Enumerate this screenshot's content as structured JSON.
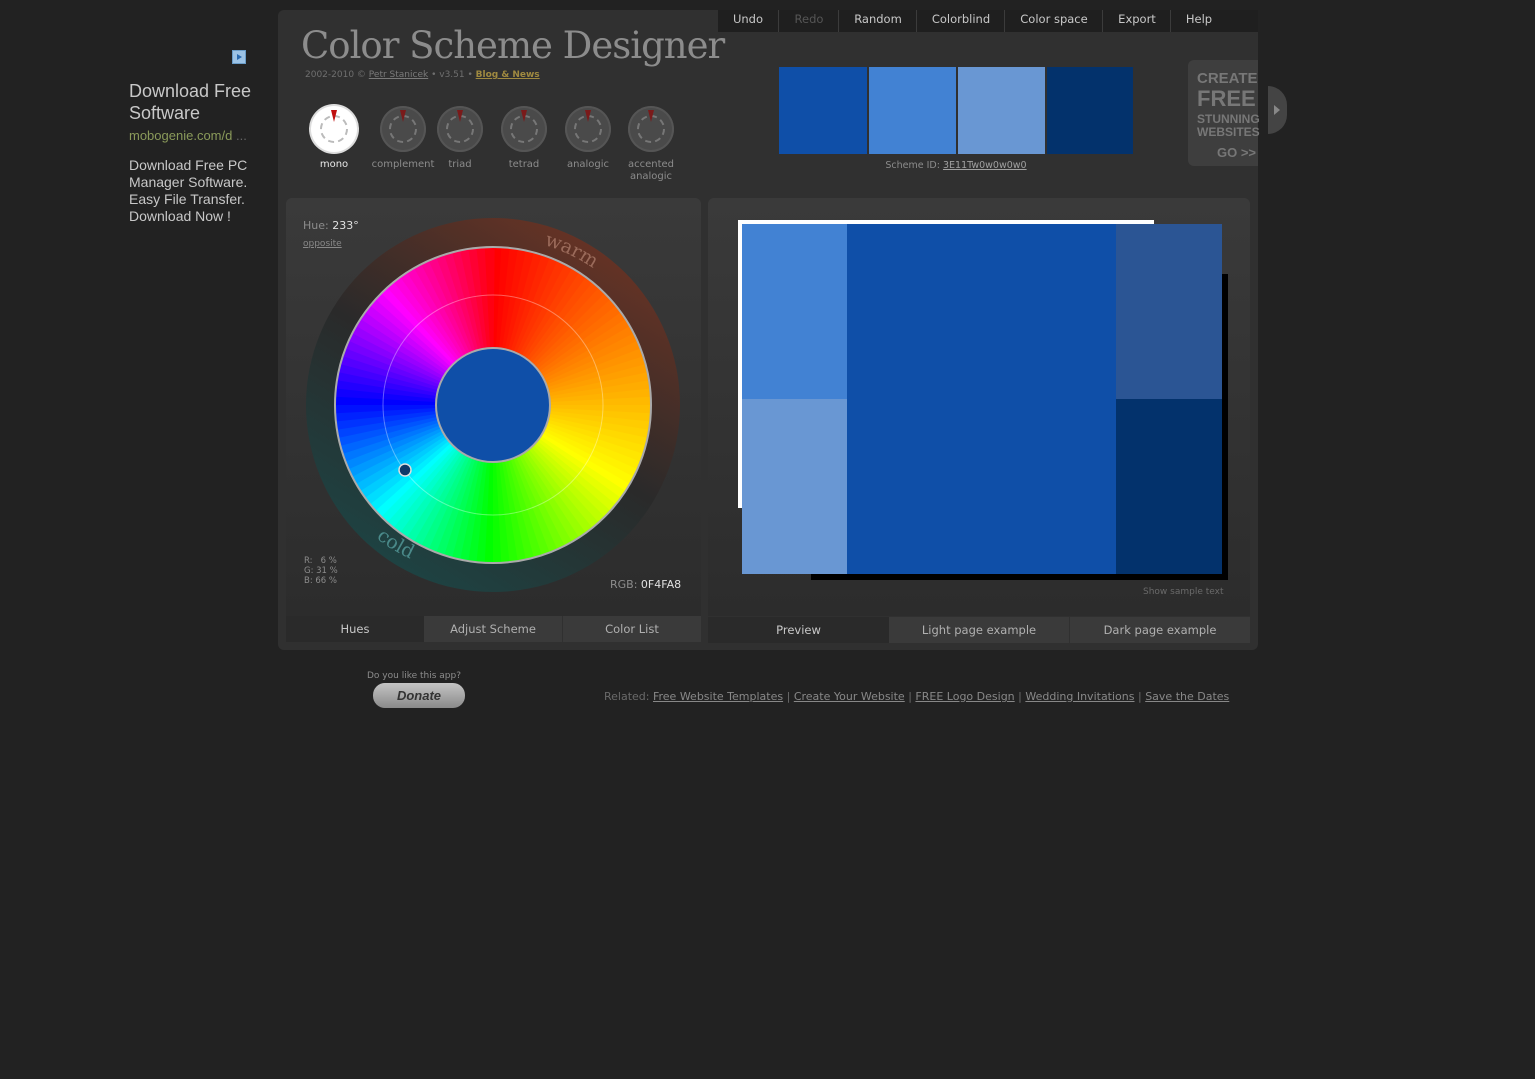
{
  "ad": {
    "title": "Download Free Software",
    "url": "mobogenie.com/d",
    "url_ellipsis": "...",
    "body": "Download Free PC Manager Software. Easy File Transfer. Download Now !"
  },
  "app": {
    "title": "Color Scheme Designer",
    "credits_prefix": "2002-2010 ©",
    "author": "Petr Stanicek",
    "version": "• v3.51 •",
    "blog": "Blog & News"
  },
  "menu": [
    {
      "label": "Undo",
      "enabled": true
    },
    {
      "label": "Redo",
      "enabled": false
    },
    {
      "label": "Random",
      "enabled": true
    },
    {
      "label": "Colorblind",
      "enabled": true
    },
    {
      "label": "Color space",
      "enabled": true
    },
    {
      "label": "Export",
      "enabled": true
    },
    {
      "label": "Help",
      "enabled": true
    }
  ],
  "schemes": [
    {
      "label": "mono",
      "active": true
    },
    {
      "label": "complement",
      "active": false
    },
    {
      "label": "triad",
      "active": false
    },
    {
      "label": "tetrad",
      "active": false
    },
    {
      "label": "analogic",
      "active": false
    },
    {
      "label": "accented analogic",
      "active": false
    }
  ],
  "palette": [
    "#0f4fa8",
    "#4282d3",
    "#6997d3",
    "#03326c"
  ],
  "scheme_id": {
    "label": "Scheme ID:",
    "value": "3E11Tw0w0w0w0"
  },
  "promo": {
    "line1": "CREATE",
    "line2": "FREE",
    "line3": "STUNNING",
    "line4": "WEBSITES",
    "line5": "GO >>"
  },
  "hue": {
    "label": "Hue:",
    "value": "233°",
    "opposite": "opposite"
  },
  "wheel": {
    "warm": "warm",
    "cold": "cold",
    "center_color": "#0f4fa8"
  },
  "rgb": {
    "r": "R:   6 %",
    "g": "G: 31 %",
    "b": "B: 66 %",
    "hex_label": "RGB:",
    "hex_value": "0F4FA8"
  },
  "left_tabs": [
    {
      "label": "Hues",
      "active": true
    },
    {
      "label": "Adjust Scheme",
      "active": false
    },
    {
      "label": "Color List",
      "active": false
    }
  ],
  "right_tabs": [
    {
      "label": "Preview",
      "active": true
    },
    {
      "label": "Light page example",
      "active": false
    },
    {
      "label": "Dark page example",
      "active": false
    }
  ],
  "show_sample_text": "Show sample text",
  "donate": {
    "question": "Do you like this app?",
    "button": "Donate"
  },
  "related": {
    "label": "Related:",
    "links": [
      "Free Website Templates",
      "Create Your Website",
      "FREE Logo Design",
      "Wedding Invitations",
      "Save the Dates"
    ],
    "separator": "|"
  }
}
